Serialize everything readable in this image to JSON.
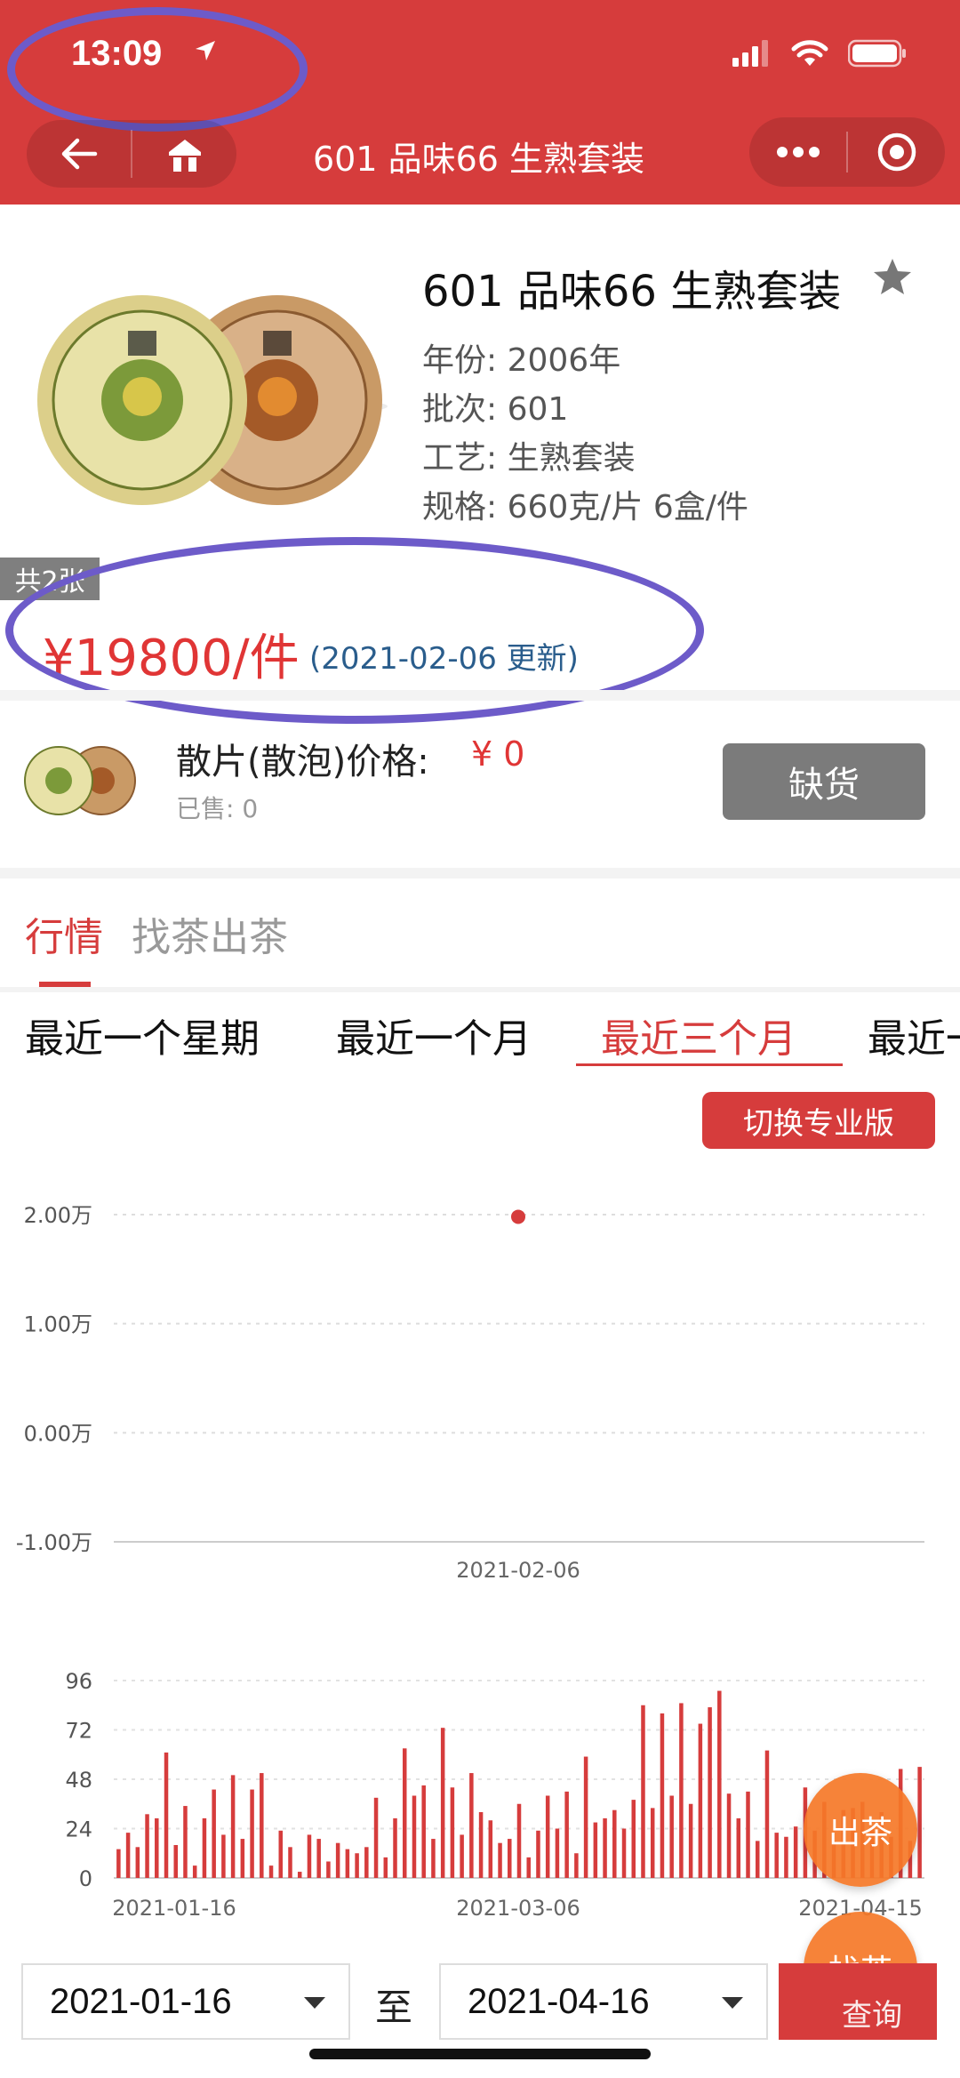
{
  "status_bar": {
    "time": "13:09"
  },
  "nav": {
    "title": "601 品味66 生熟套装"
  },
  "product": {
    "title": "601 品味66 生熟套装",
    "year": "年份: 2006年",
    "batch": "批次: 601",
    "craft": "工艺: 生熟套装",
    "spec": "规格: 660克/片 6盒/件",
    "image_count": "共2张",
    "price": "¥19800/件",
    "update": "(2021-02-06 更新)"
  },
  "bulk": {
    "label": "散片(散泡)价格:",
    "value": "¥ 0",
    "sold": "已售: 0",
    "stock_button": "缺货"
  },
  "tabs": [
    "行情",
    "找茶出茶"
  ],
  "periods": [
    "最近一个星期",
    "最近一个月",
    "最近三个月",
    "最近一"
  ],
  "pro_button": "切换专业版",
  "colors": {
    "brand": "#d63c3c",
    "price": "#e03535",
    "update_text": "#2a5d8c",
    "annotation": "#6d5bc9"
  },
  "chart_data": [
    {
      "type": "scatter",
      "y_ticks": [
        "2.00万",
        "1.00万",
        "0.00万",
        "-1.00万"
      ],
      "ylim": [
        -1.0,
        2.0
      ],
      "y_unit": "万",
      "x_ticks": [
        "2021-02-06"
      ],
      "points": [
        {
          "x": "2021-02-06",
          "y": 1.98
        }
      ]
    },
    {
      "type": "bar",
      "y_ticks": [
        "96",
        "72",
        "48",
        "24",
        "0"
      ],
      "ylim": [
        0,
        96
      ],
      "x_ticks": [
        "2021-01-16",
        "2021-03-06",
        "2021-04-15"
      ],
      "values": [
        14,
        22,
        15,
        31,
        29,
        61,
        16,
        35,
        6,
        29,
        43,
        21,
        50,
        19,
        43,
        51,
        6,
        23,
        15,
        3,
        21,
        19,
        8,
        17,
        14,
        12,
        15,
        39,
        10,
        29,
        63,
        40,
        45,
        19,
        73,
        44,
        21,
        51,
        32,
        28,
        17,
        19,
        36,
        10,
        23,
        40,
        24,
        42,
        12,
        59,
        27,
        29,
        33,
        24,
        38,
        84,
        34,
        80,
        40,
        85,
        36,
        75,
        83,
        91,
        41,
        29,
        42,
        18,
        62,
        22,
        20,
        25,
        44,
        23,
        37,
        18,
        33,
        34,
        37,
        25,
        32,
        20,
        53,
        18,
        54
      ]
    }
  ],
  "fabs": {
    "sell": "出茶",
    "find": "找茶"
  },
  "date_range": {
    "start": "2021-01-16",
    "sep": "至",
    "end": "2021-04-16",
    "query": "查询"
  }
}
